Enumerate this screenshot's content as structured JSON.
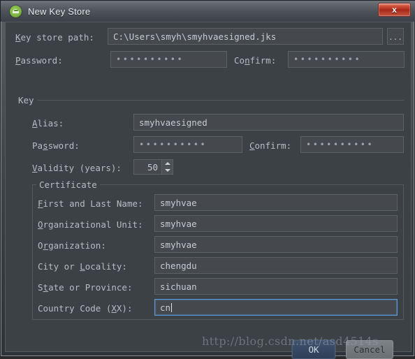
{
  "window": {
    "title": "New Key Store",
    "icon": "android-studio-icon",
    "close_label": "x"
  },
  "keystore": {
    "path_label": "Key store path:",
    "path_value": "C:\\Users\\smyh\\smyhvaesigned.jks",
    "browse_label": "...",
    "password_label": "Password:",
    "password_value": "••••••••••",
    "confirm_label": "Confirm:",
    "confirm_value": "••••••••••"
  },
  "key": {
    "group_title": "Key",
    "alias_label": "Alias:",
    "alias_value": "smyhvaesigned",
    "password_label": "Password:",
    "password_value": "••••••••••",
    "confirm_label": "Confirm:",
    "confirm_value": "••••••••••",
    "validity_label": "Validity (years):",
    "validity_value": "50"
  },
  "certificate": {
    "group_title": "Certificate",
    "rows": [
      {
        "label": "First and Last Name:",
        "value": "smyhvae",
        "focused": false
      },
      {
        "label": "Organizational Unit:",
        "value": "smyhvae",
        "focused": false
      },
      {
        "label": "Organization:",
        "value": "smyhvae",
        "focused": false
      },
      {
        "label": "City or Locality:",
        "value": "chengdu",
        "focused": false
      },
      {
        "label": "State or Province:",
        "value": "sichuan",
        "focused": false
      },
      {
        "label": "Country Code (XX):",
        "value": "cn",
        "focused": true
      }
    ]
  },
  "buttons": {
    "ok_label": "OK",
    "cancel_label": "Cancel"
  },
  "watermark": {
    "text": "http://blog.csdn.net/asd4514s"
  },
  "colors": {
    "dialog_bg": "#3c4145",
    "field_bg": "#45494d",
    "text": "#b6bdc2",
    "focus_border": "#5a9ad6",
    "ok_button": "#2e3f57",
    "close_button": "#a8291a"
  }
}
